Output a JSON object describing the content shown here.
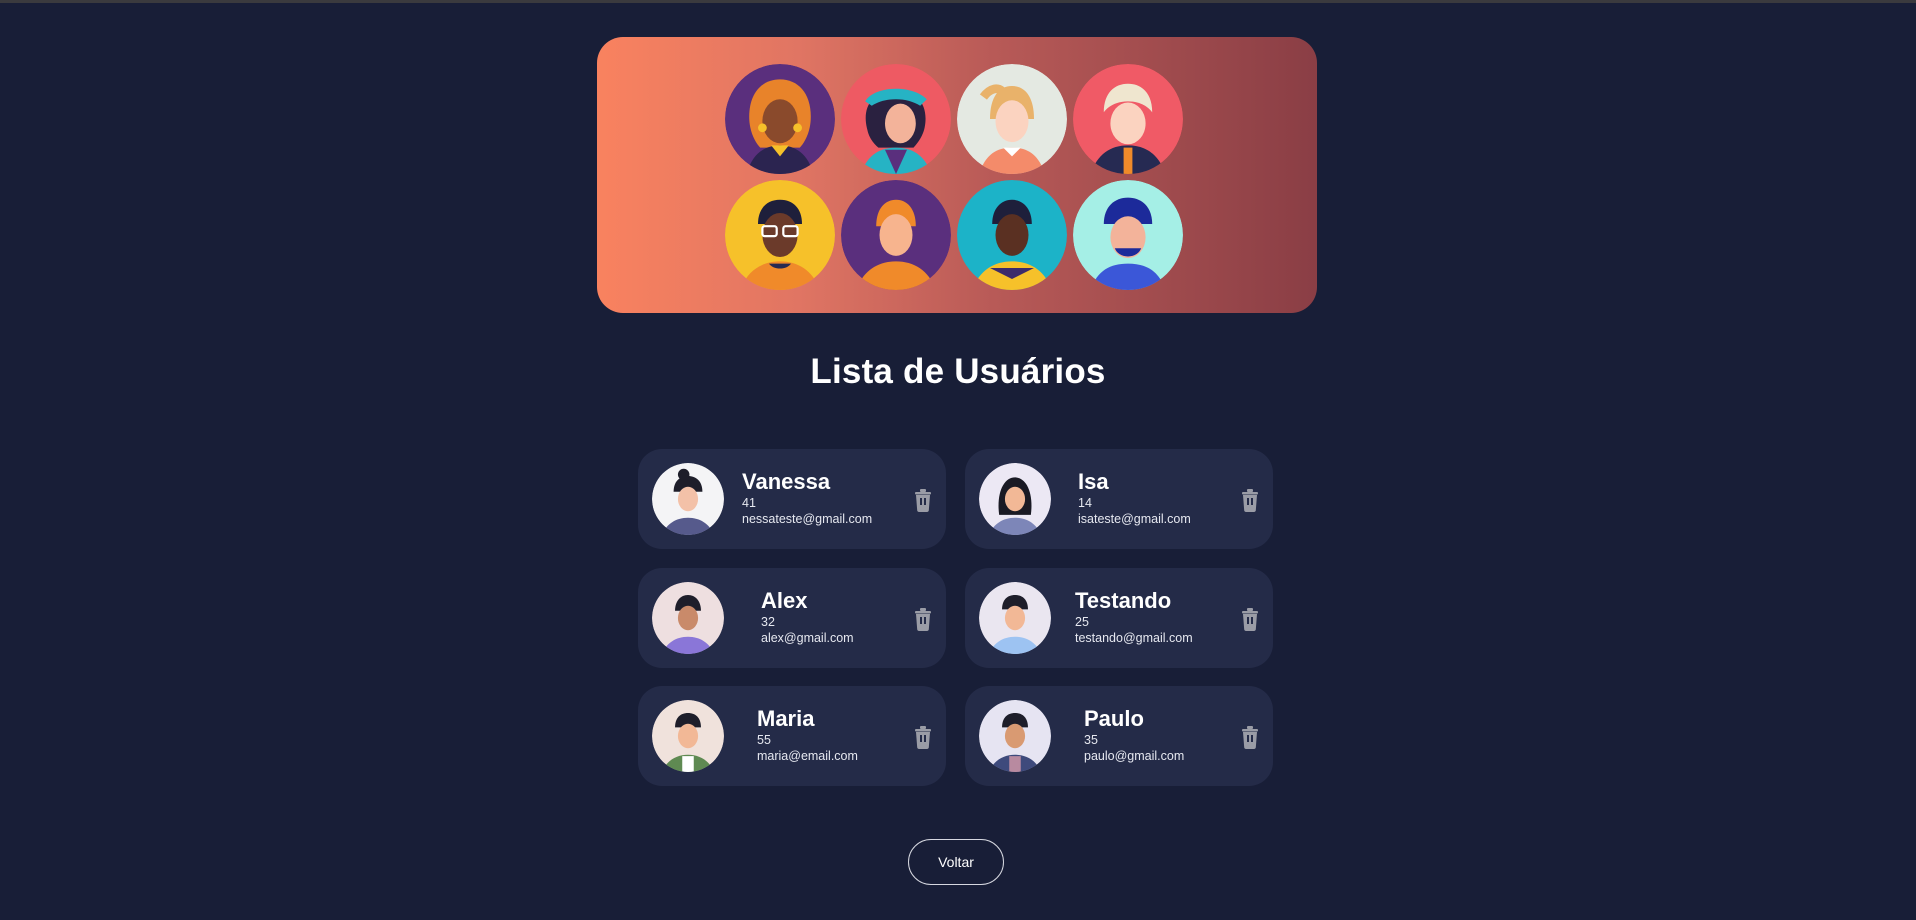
{
  "page": {
    "title": "Lista de Usuários",
    "back_label": "Voltar"
  },
  "hero": {
    "avatars": [
      "avatar-1",
      "avatar-2",
      "avatar-3",
      "avatar-4",
      "avatar-5",
      "avatar-6",
      "avatar-7",
      "avatar-8"
    ]
  },
  "users": [
    {
      "name": "Vanessa",
      "age": "41",
      "email": "nessateste@gmail.com"
    },
    {
      "name": "Isa",
      "age": "14",
      "email": "isateste@gmail.com"
    },
    {
      "name": "Alex",
      "age": "32",
      "email": "alex@gmail.com"
    },
    {
      "name": "Testando",
      "age": "25",
      "email": "testando@gmail.com"
    },
    {
      "name": "Maria",
      "age": "55",
      "email": "maria@email.com"
    },
    {
      "name": "Paulo",
      "age": "35",
      "email": "paulo@gmail.com"
    }
  ],
  "icons": {
    "delete": "trash-icon"
  },
  "colors": {
    "background": "#181e37",
    "card": "#242b48",
    "hero_start": "#f9825f",
    "hero_end": "#8a3e45"
  }
}
